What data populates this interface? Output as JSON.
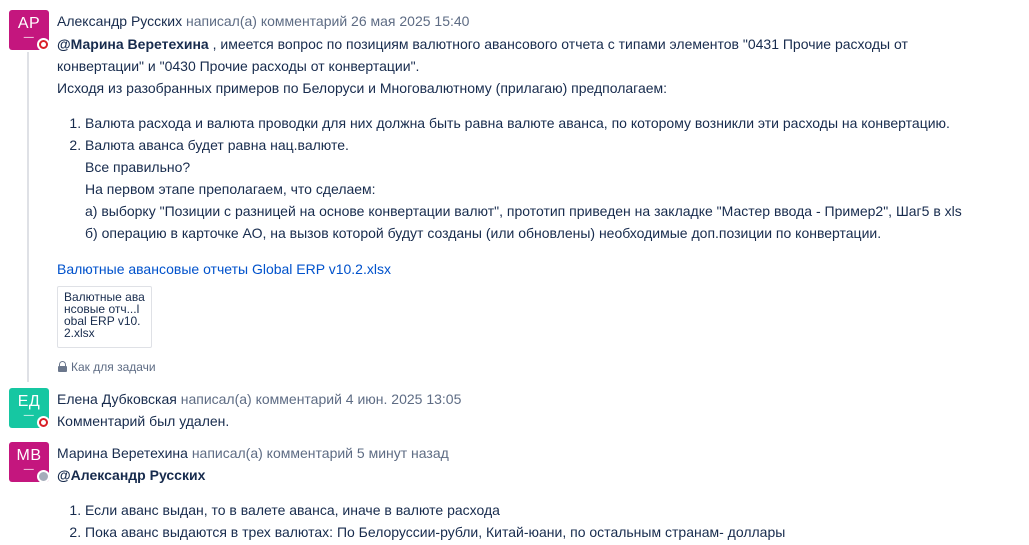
{
  "colors": {
    "avatar_ap": "#c4167e",
    "avatar_ed": "#16c7a2",
    "avatar_mv": "#c4167e",
    "link": "#0052cc",
    "meta_text": "#5e6c84"
  },
  "comments": [
    {
      "avatar_initials": "АР",
      "avatar_dash": "—",
      "author": "Александр Русских",
      "action": "написал(а) комментарий",
      "date": "26 мая 2025 15:40",
      "mention": "@Марина Веретехина",
      "line1_rest": " , имеется вопрос по позициям валютного авансового отчета с типами элементов \"0431 Прочие расходы от",
      "line2": "конвертации\" и \"0430 Прочие расходы от конвертации\".",
      "line3": "Исходя из разобранных примеров по Белоруси и Многовалютному (прилагаю) предполагаем:",
      "list": [
        "Валюта расхода и валюта проводки для них должна быть равна валюте аванса, по которому возникли эти расходы на конвертацию.",
        "Валюта аванса будет равна нац.валюте."
      ],
      "sub_lines": [
        "Все правильно?",
        "На первом этапе преполагаем, что сделаем:",
        "а) выборку \"Позиции с разницей на основе конвертации валют\", прототип приведен на закладке \"Мастер ввода - Пример2\", Шаг5 в xls",
        "б) операцию в карточке АО, на вызов которой будут созданы (или обновлены) необходимые доп.позиции по конвертации."
      ],
      "attachment_link": "Валютные авансовые отчеты Global ERP v10.2.xlsx",
      "thumbnail_lines": [
        "Валютные ава",
        "нсовые отч...l",
        "obal ERP v10.",
        "2.xlsx"
      ],
      "restriction": "Как для задачи"
    },
    {
      "avatar_initials": "ЕД",
      "avatar_dash": "—",
      "author": "Елена Дубковская",
      "action": "написал(а) комментарий",
      "date": "4 июн. 2025 13:05",
      "text": "Комментарий был удален."
    },
    {
      "avatar_initials": "МВ",
      "avatar_dash": "—",
      "author": "Марина Веретехина",
      "action": "написал(а) комментарий",
      "date": "5 минут назад",
      "mention": "@Александр Русских",
      "list": [
        "Если аванс выдан, то в валете аванса, иначе в валюте расхода",
        "Пока аванс выдаются в трех валютах: По Белоруссии-рубли, Китай-юани, по остальным странам- доллары"
      ]
    }
  ]
}
